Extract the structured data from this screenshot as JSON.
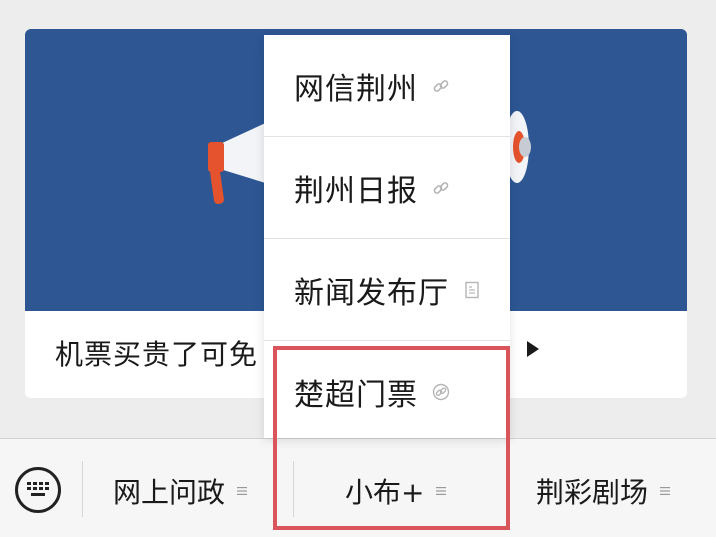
{
  "card": {
    "title": "机票买贵了可免"
  },
  "popup": {
    "items": [
      {
        "label": "网信荆州",
        "icon": "link-icon"
      },
      {
        "label": "荆州日报",
        "icon": "link-icon"
      },
      {
        "label": "新闻发布厅",
        "icon": "article-icon"
      },
      {
        "label": "楚超门票",
        "icon": "link-circle-icon"
      }
    ]
  },
  "bottom_bar": {
    "keyboard_icon": "keyboard-icon",
    "tabs": [
      {
        "label": "网上问政",
        "icon": "menu-icon"
      },
      {
        "label": "小布+",
        "icon": "menu-icon"
      },
      {
        "label": "荆彩剧场",
        "icon": "menu-icon"
      }
    ]
  },
  "colors": {
    "banner_blue": "#2d5693",
    "highlight_red": "#d9545b",
    "megaphone_orange": "#e4532d"
  }
}
